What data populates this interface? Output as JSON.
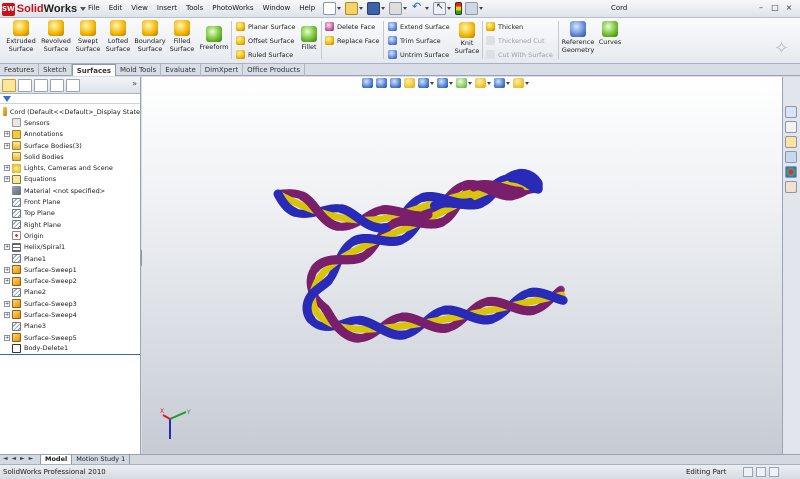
{
  "app": {
    "logo_mark": "SW",
    "logo_text_a": "Solid",
    "logo_text_b": "Works",
    "document_title": "Cord",
    "window_controls": [
      "–",
      "□",
      "×"
    ]
  },
  "menus": [
    "File",
    "Edit",
    "View",
    "Insert",
    "Tools",
    "PhotoWorks",
    "Window",
    "Help"
  ],
  "pin": "⊣",
  "ribbon": {
    "big_buttons": [
      {
        "line1": "Extruded",
        "line2": "Surface",
        "icon": "extruded-surface-icon"
      },
      {
        "line1": "Revolved",
        "line2": "Surface",
        "icon": "revolved-surface-icon"
      },
      {
        "line1": "Swept",
        "line2": "Surface",
        "icon": "swept-surface-icon"
      },
      {
        "line1": "Lofted",
        "line2": "Surface",
        "icon": "lofted-surface-icon"
      },
      {
        "line1": "Boundary",
        "line2": "Surface",
        "icon": "boundary-surface-icon"
      },
      {
        "line1": "Filled",
        "line2": "Surface",
        "icon": "filled-surface-icon"
      },
      {
        "line1": "Freeform",
        "line2": "",
        "icon": "freeform-icon"
      }
    ],
    "col1": [
      "Planar Surface",
      "Offset Surface",
      "Ruled Surface"
    ],
    "fillet": "Fillet",
    "col2": [
      "Delete Face",
      "Replace Face"
    ],
    "col3": [
      "Extend Surface",
      "Trim Surface",
      "Untrim Surface"
    ],
    "knit": {
      "line1": "Knit",
      "line2": "Surface"
    },
    "col4": [
      "Thicken",
      "Thickened Cut",
      "Cut With Surface"
    ],
    "reference": {
      "line1": "Reference",
      "line2": "Geometry"
    },
    "curves": "Curves"
  },
  "tabs": [
    "Features",
    "Sketch",
    "Surfaces",
    "Mold Tools",
    "Evaluate",
    "DimXpert",
    "Office Products"
  ],
  "active_tab": "Surfaces",
  "panel_expand": "»",
  "tree": [
    {
      "label": "Cord  (Default<<Default>_Display State",
      "icon": "part-icon",
      "expand": ""
    },
    {
      "label": "Sensors",
      "icon": "sensors-icon",
      "expand": ""
    },
    {
      "label": "Annotations",
      "icon": "annotations-icon",
      "expand": "+"
    },
    {
      "label": "Surface Bodies(3)",
      "icon": "surface-bodies-folder-icon",
      "expand": "+"
    },
    {
      "label": "Solid Bodies",
      "icon": "solid-bodies-folder-icon",
      "expand": ""
    },
    {
      "label": "Lights, Cameras and Scene",
      "icon": "lights-icon",
      "expand": "+"
    },
    {
      "label": "Equations",
      "icon": "equations-icon",
      "expand": "+"
    },
    {
      "label": "Material <not specified>",
      "icon": "material-icon",
      "expand": ""
    },
    {
      "label": "Front Plane",
      "icon": "plane-icon",
      "expand": ""
    },
    {
      "label": "Top Plane",
      "icon": "plane-icon",
      "expand": ""
    },
    {
      "label": "Right Plane",
      "icon": "plane-icon",
      "expand": ""
    },
    {
      "label": "Origin",
      "icon": "origin-icon",
      "expand": ""
    },
    {
      "label": "Helix/Spiral1",
      "icon": "helix-icon",
      "expand": "+"
    },
    {
      "label": "Plane1",
      "icon": "plane-icon",
      "expand": ""
    },
    {
      "label": "Surface-Sweep1",
      "icon": "sweep-icon",
      "expand": "+"
    },
    {
      "label": "Surface-Sweep2",
      "icon": "sweep-icon",
      "expand": "+"
    },
    {
      "label": "Plane2",
      "icon": "plane-icon",
      "expand": ""
    },
    {
      "label": "Surface-Sweep3",
      "icon": "sweep-icon",
      "expand": "+"
    },
    {
      "label": "Surface-Sweep4",
      "icon": "sweep-icon",
      "expand": "+"
    },
    {
      "label": "Plane3",
      "icon": "plane-icon",
      "expand": ""
    },
    {
      "label": "Surface-Sweep5",
      "icon": "sweep-icon",
      "expand": "+"
    },
    {
      "label": "Body-Delete1",
      "icon": "body-delete-icon",
      "expand": ""
    }
  ],
  "triad": {
    "x": "X",
    "y": "Y"
  },
  "colors": {
    "strand_blue": "#2a2ab8",
    "strand_purple": "#7a1f6b",
    "core_yellow": "#d8c40a"
  },
  "bottom_tabs": [
    "Model",
    "Motion Study 1"
  ],
  "bottom_arrows": "◄ ◄ ► ►",
  "status": {
    "product": "SolidWorks Professional 2010",
    "mode": "Editing Part"
  }
}
